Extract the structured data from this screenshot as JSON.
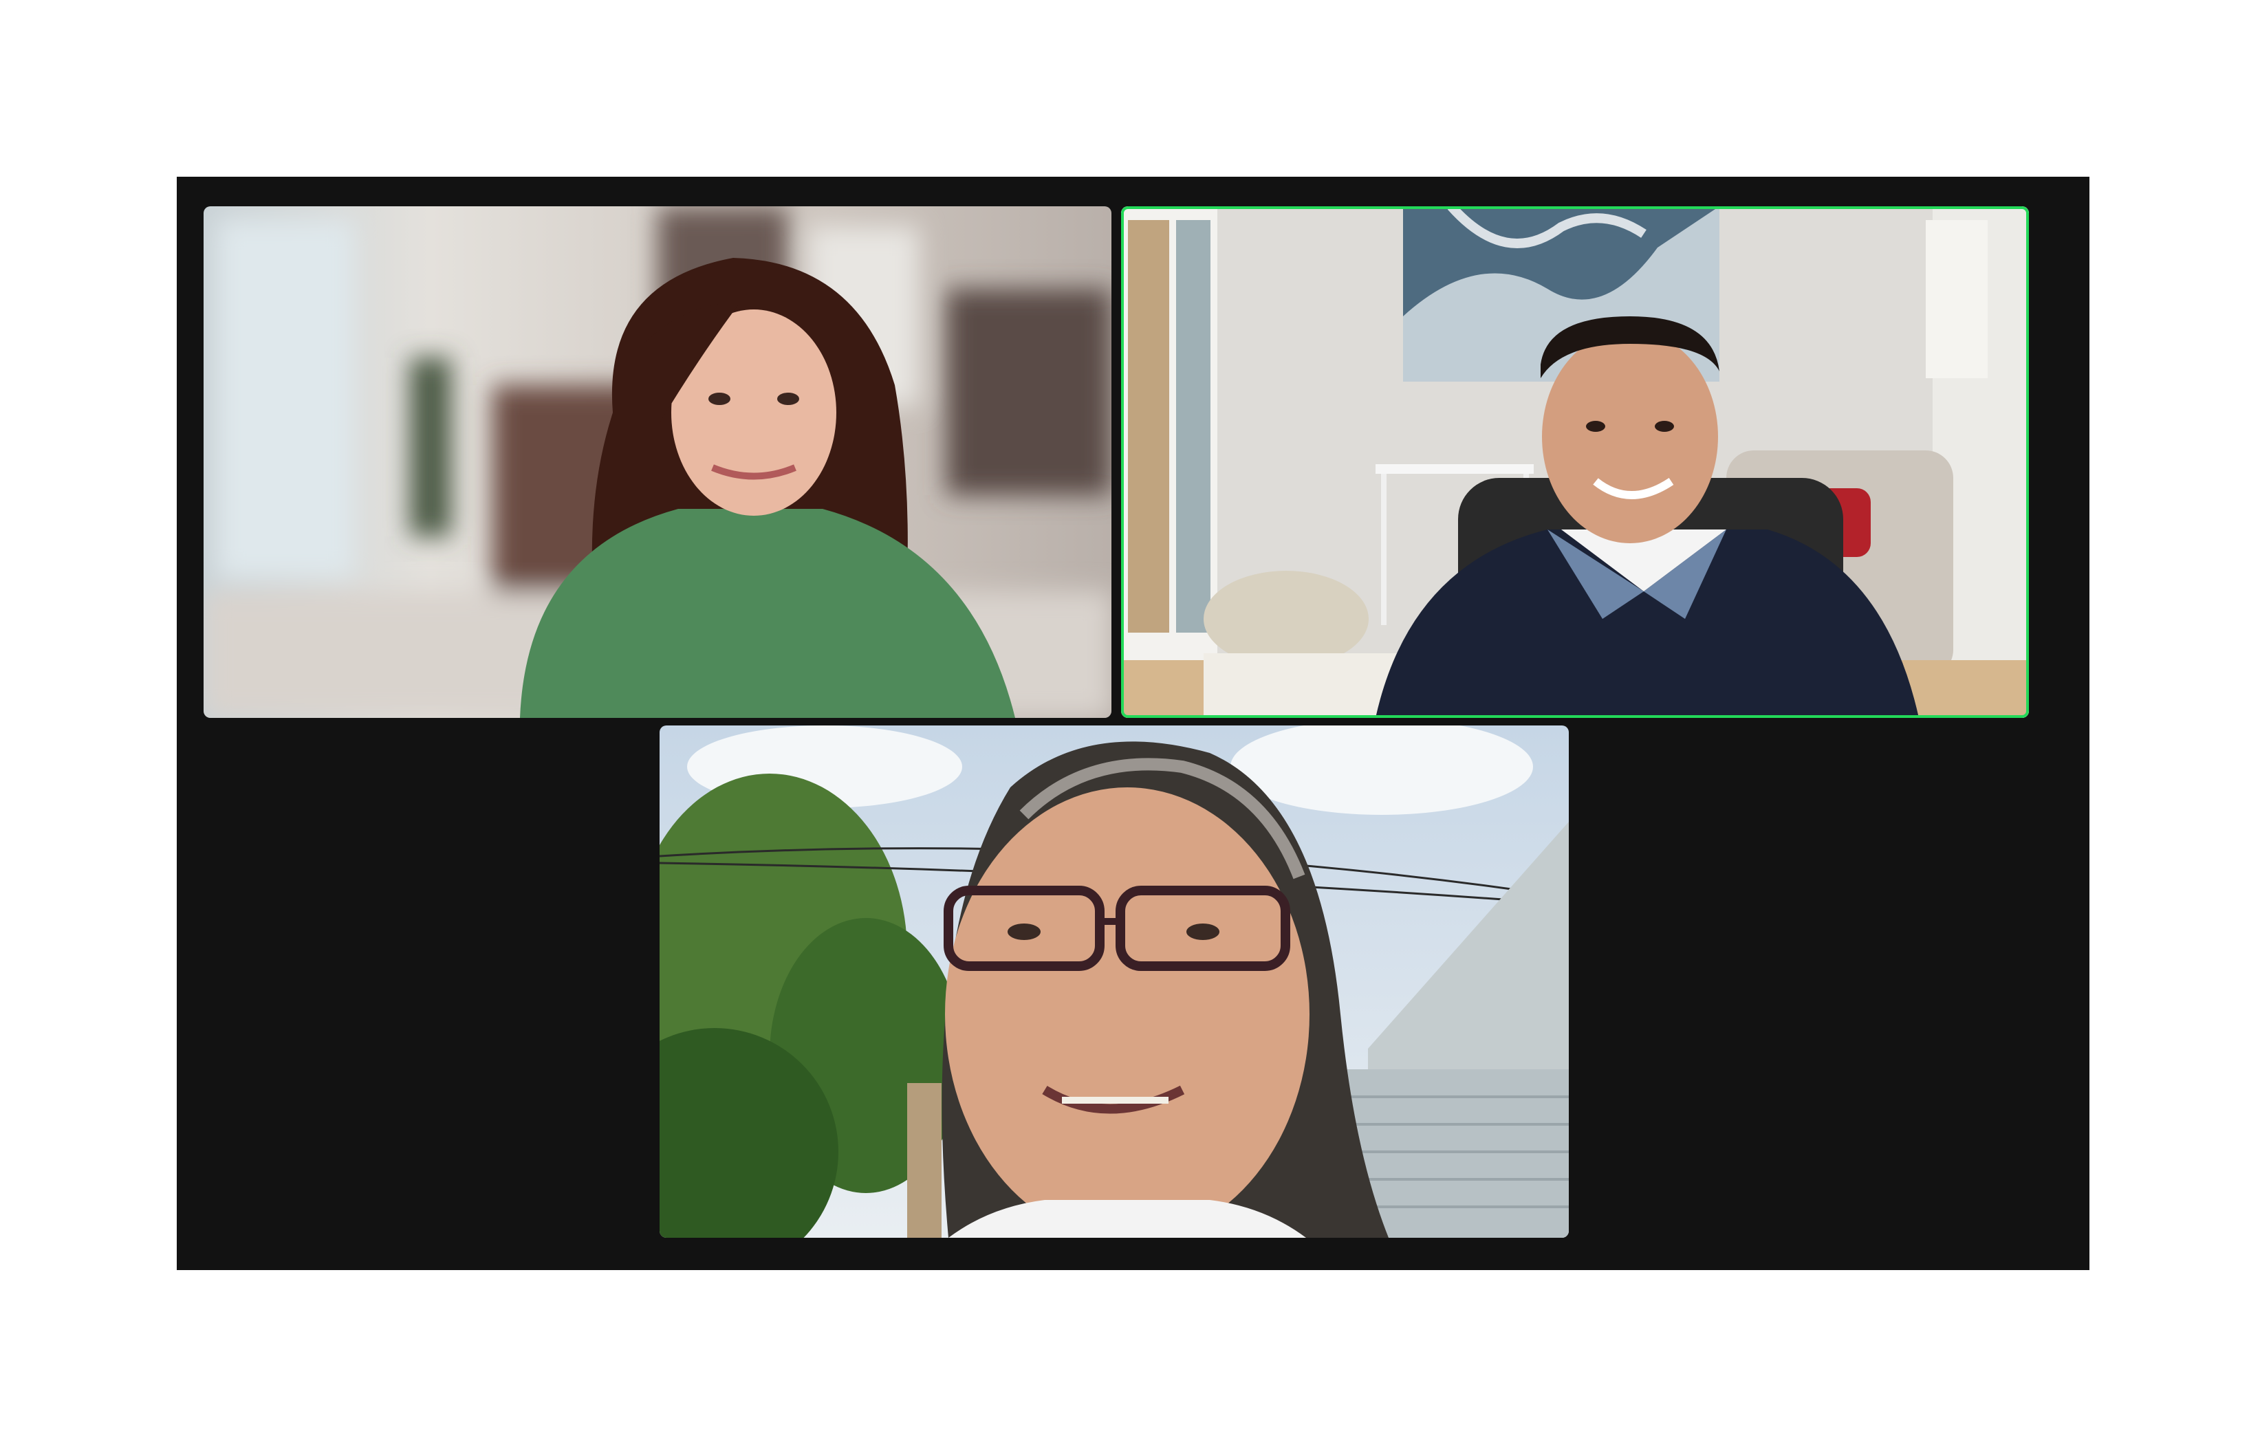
{
  "meeting": {
    "layout": "gallery",
    "participants": [
      {
        "id": "participant-1",
        "active_speaker": false,
        "video": "woman-green-shirt-home"
      },
      {
        "id": "participant-2",
        "active_speaker": true,
        "video": "man-navy-polo-office"
      },
      {
        "id": "participant-3",
        "active_speaker": false,
        "video": "woman-glasses-outdoors"
      }
    ],
    "colors": {
      "background": "#121212",
      "active_speaker_border": "#23d959"
    }
  }
}
